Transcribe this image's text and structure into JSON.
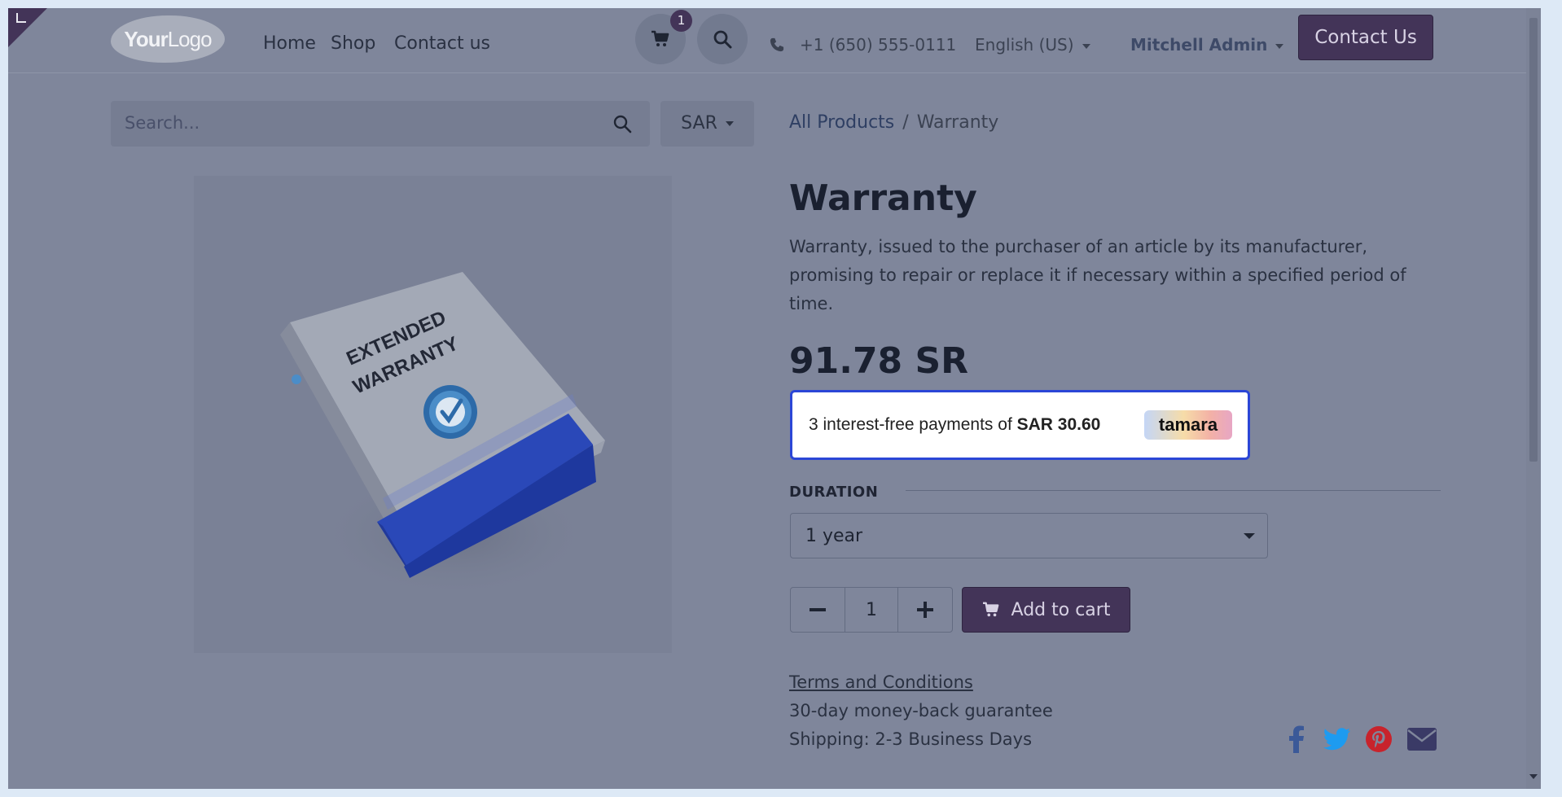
{
  "header": {
    "logo_text_bold": "Your",
    "logo_text": "Logo",
    "nav": [
      {
        "label": "Home"
      },
      {
        "label": "Shop"
      },
      {
        "label": "Contact us"
      }
    ],
    "cart_count": "1",
    "phone": "+1 (650) 555-0111",
    "language": "English (US)",
    "user": "Mitchell Admin",
    "contact_button": "Contact Us"
  },
  "search": {
    "placeholder": "Search...",
    "currency": "SAR"
  },
  "breadcrumb": {
    "parent": "All Products",
    "separator": "/",
    "current": "Warranty"
  },
  "product": {
    "name": "Warranty",
    "description": "Warranty, issued to the purchaser of an article by its manufacturer, promising to repair or replace it if necessary within a specified period of time.",
    "price": "91.78 SR",
    "image_text_1": "EXTENDED",
    "image_text_2": "WARRANTY",
    "tamara": {
      "text": "3 interest-free payments of ",
      "amount": "SAR 30.60",
      "logo": "tamara"
    },
    "attribute_label": "DURATION",
    "attribute_value": "1 year",
    "quantity": "1",
    "add_to_cart": "Add to cart",
    "terms": "Terms and Conditions",
    "guarantee": "30-day money-back guarantee",
    "shipping": "Shipping: 2-3 Business Days"
  },
  "icons": {
    "cart": "cart-icon",
    "search": "search-icon",
    "phone": "phone-icon",
    "share": [
      "facebook-icon",
      "twitter-icon",
      "pinterest-icon",
      "email-icon"
    ]
  },
  "colors": {
    "brand": "#433458",
    "tamara_border": "#2b46d6",
    "facebook": "#3b5998",
    "twitter": "#1d9bf0",
    "pinterest": "#c8232c",
    "email": "#3a3a66"
  }
}
